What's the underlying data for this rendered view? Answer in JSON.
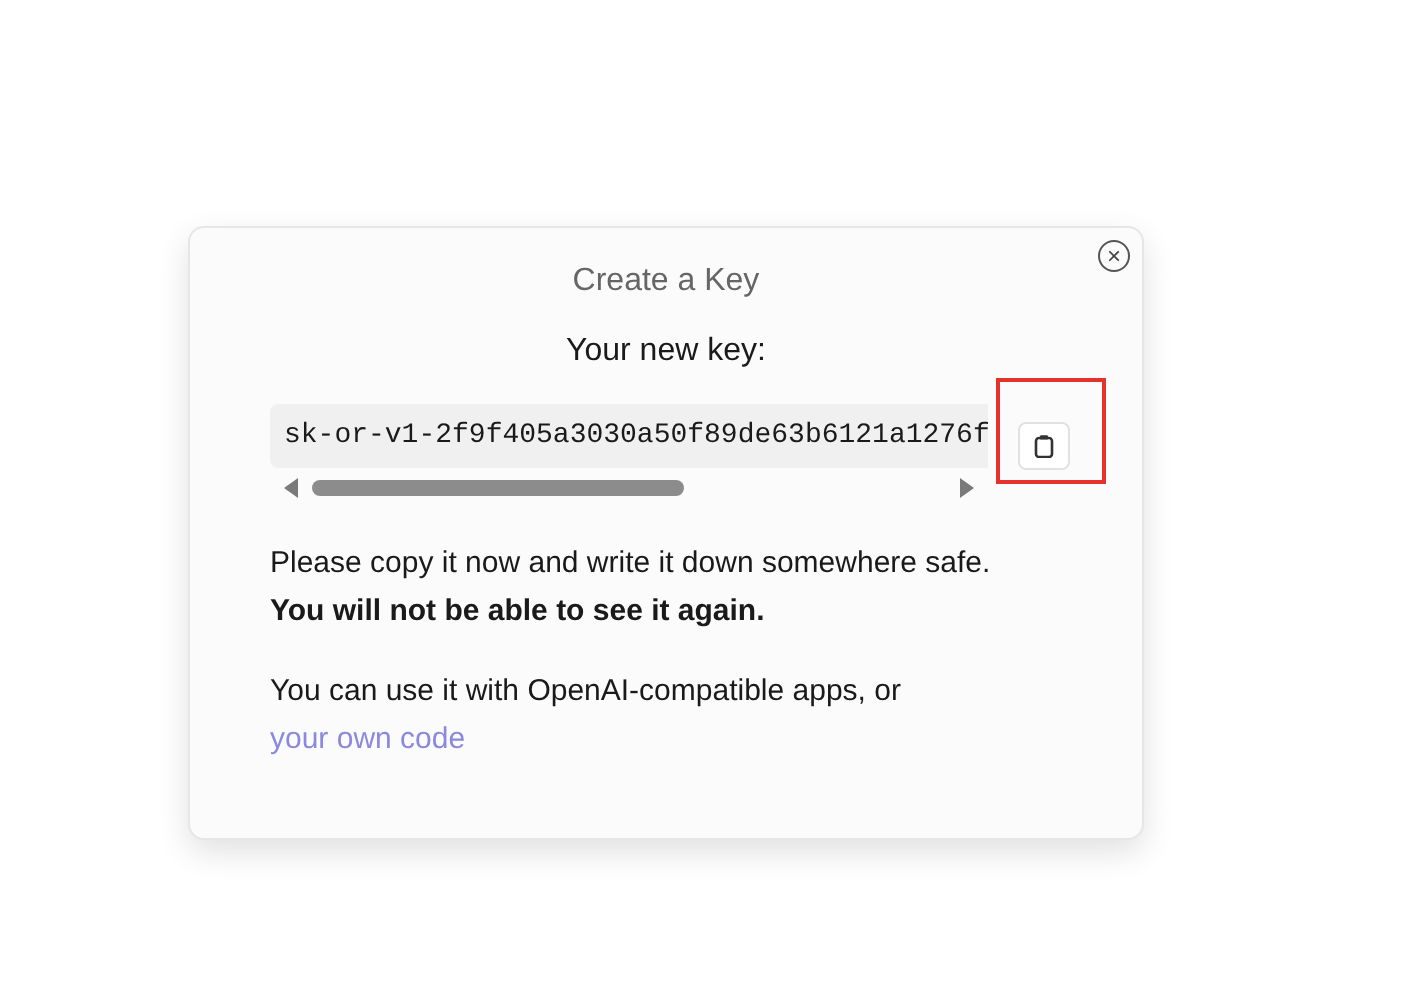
{
  "dialog": {
    "title": "Create a Key",
    "close_icon": "×",
    "key_label": "Your new key:",
    "key_value": "sk-or-v1-2f9f405a3030a50f89de63b6121a1276f",
    "copy_button": {
      "highlighted": true
    },
    "warning": "Please copy it now and write it down somewhere safe. **You will not be able to see it again.**",
    "usage": {
      "text": "You can use it with OpenAI-compatible apps, or",
      "link": "your own code"
    }
  }
}
